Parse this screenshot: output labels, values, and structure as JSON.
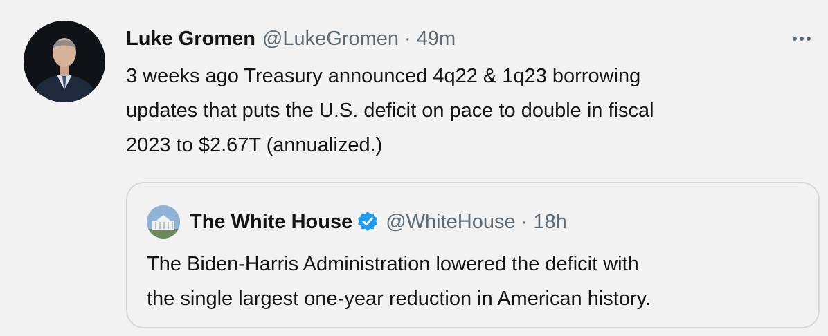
{
  "tweet": {
    "author_name": "Luke Gromen",
    "handle": "@LukeGromen",
    "separator": "·",
    "time": "49m",
    "more_icon": "more-horizontal-icon",
    "text": "3 weeks ago Treasury announced 4q22 & 1q23 borrowing\nupdates that puts the U.S. deficit on pace to double in fiscal\n2023 to $2.67T (annualized.)"
  },
  "quoted_tweet": {
    "author_name": "The White House",
    "verified_icon": "verified-badge-icon",
    "handle": "@WhiteHouse",
    "separator": "·",
    "time": "18h",
    "text": "The Biden-Harris Administration lowered the deficit with\nthe single largest one-year reduction in American history."
  },
  "colors": {
    "background": "#f2f2f2",
    "text": "#141414",
    "muted": "#5f6b74",
    "border": "#d3d8dc",
    "verified": "#1d9bf0"
  }
}
